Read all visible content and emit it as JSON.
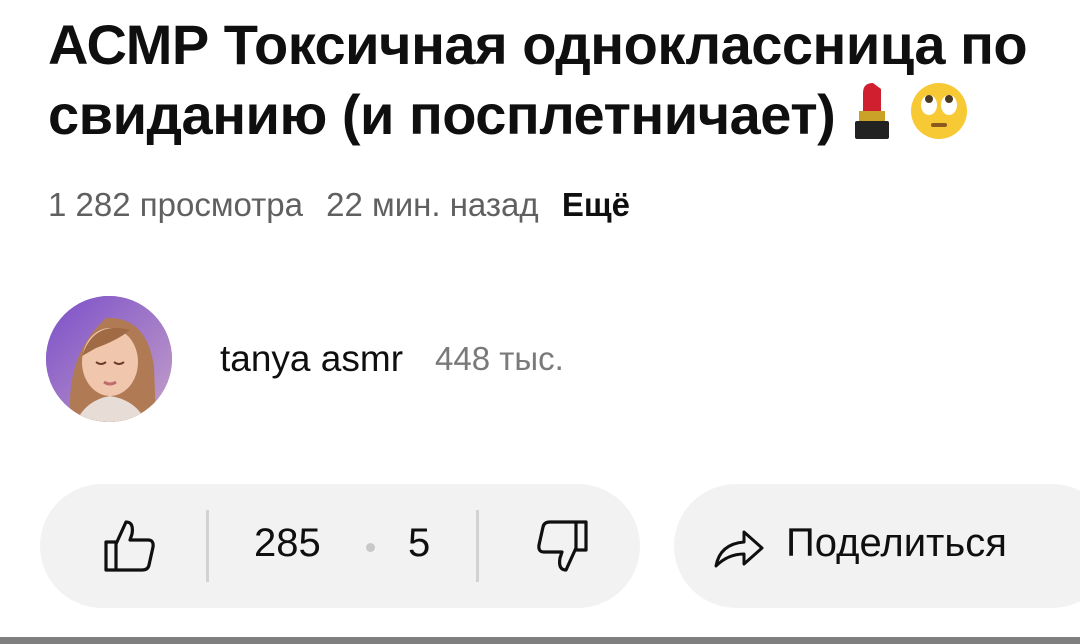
{
  "video": {
    "title_line1": "АСМР Токсичная одноклассница по",
    "title_line2": "свиданию (и посплетничает)",
    "title_emojis": [
      "lipstick-icon",
      "rolling-eyes-icon"
    ],
    "views": "1 282 просмотра",
    "time_ago": "22 мин. назад",
    "more_label": "Ещё"
  },
  "channel": {
    "name": "tanya asmr",
    "subscribers": "448 тыс."
  },
  "actions": {
    "likes": "285",
    "dislikes": "5",
    "share_label": "Поделиться"
  },
  "colors": {
    "pill_bg": "#f2f2f2",
    "secondary_text": "#606060",
    "lipstick": "#d0202f",
    "emoji_yellow": "#f7c934"
  }
}
